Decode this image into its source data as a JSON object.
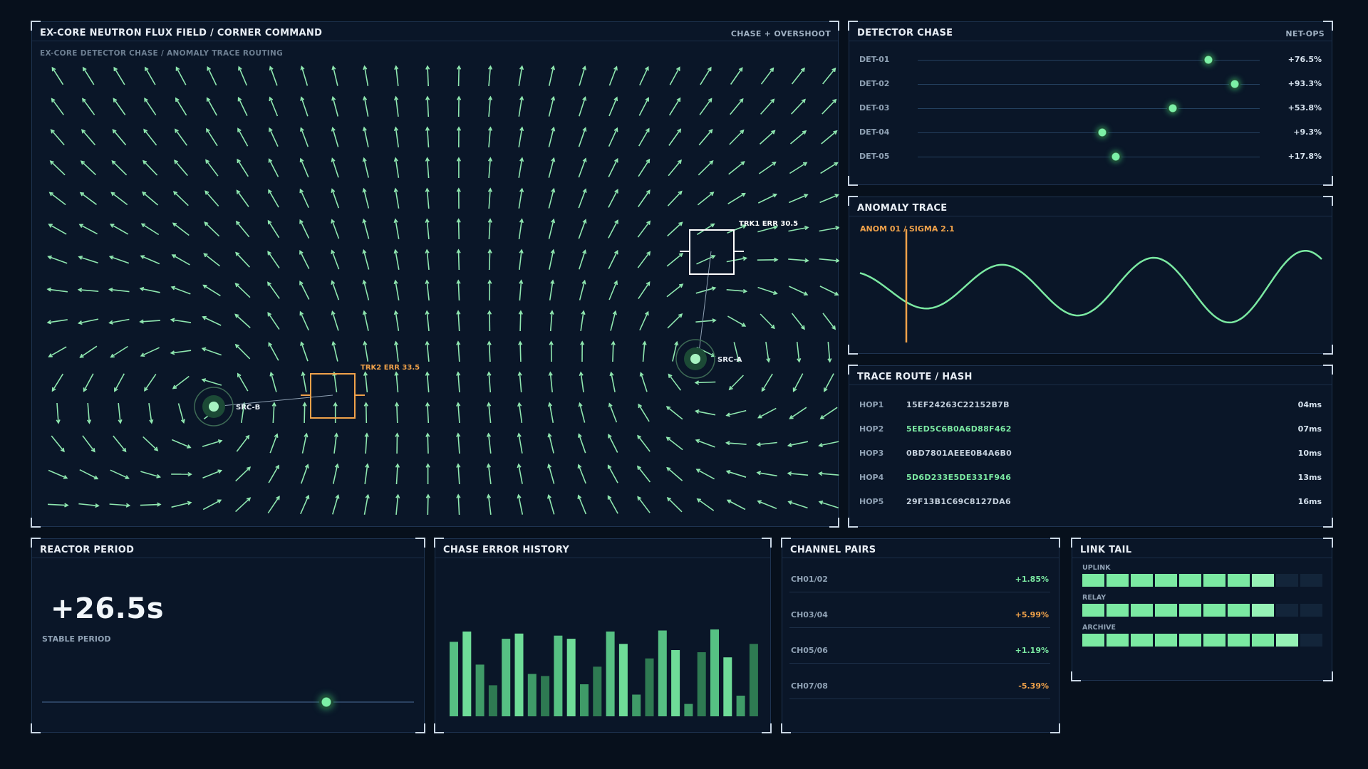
{
  "flux": {
    "title": "EX-CORE NEUTRON FLUX FIELD / CORNER COMMAND",
    "mode": "CHASE + OVERSHOOT",
    "subtitle": "EX-CORE DETECTOR CHASE / ANOMALY TRACE ROUTING",
    "sources": [
      {
        "label": "SRC-A"
      },
      {
        "label": "SRC-B"
      }
    ],
    "trackers": [
      {
        "label": "TRK1 ERR 30.5",
        "color": "#ffffff"
      },
      {
        "label": "TRK2 ERR 33.5",
        "color": "#f0a24a"
      }
    ]
  },
  "detector": {
    "title": "DETECTOR CHASE",
    "tag": "NET-OPS",
    "rows": [
      {
        "label": "DET-01",
        "value": "+76.5%",
        "level": 0.85
      },
      {
        "label": "DET-02",
        "value": "+93.3%",
        "level": 0.927
      },
      {
        "label": "DET-03",
        "value": "+53.8%",
        "level": 0.745
      },
      {
        "label": "DET-04",
        "value": "+9.3%",
        "level": 0.54
      },
      {
        "label": "DET-05",
        "value": "+17.8%",
        "level": 0.58
      }
    ]
  },
  "anomaly": {
    "title": "ANOMALY TRACE",
    "marker_label": "ANOM 01 / SIGMA 2.1",
    "marker_color": "#f0a24a",
    "wave_color": "#7be9a2"
  },
  "trace": {
    "title": "TRACE ROUTE / HASH",
    "hops": [
      {
        "id": "HOP1",
        "hash": "15EF24263C22152B7B",
        "ms": "04ms",
        "green": false
      },
      {
        "id": "HOP2",
        "hash": "5EED5C6B0A6D88F462",
        "ms": "07ms",
        "green": true
      },
      {
        "id": "HOP3",
        "hash": "0BD7801AEEE0B4A6B0",
        "ms": "10ms",
        "green": false
      },
      {
        "id": "HOP4",
        "hash": "5D6D233E5DE331F946",
        "ms": "13ms",
        "green": true
      },
      {
        "id": "HOP5",
        "hash": "29F13B1C69C8127DA6",
        "ms": "16ms",
        "green": false
      }
    ]
  },
  "reactor": {
    "title": "REACTOR PERIOD",
    "value": "+26.5s",
    "caption": "STABLE PERIOD",
    "slider_level": 0.765
  },
  "history": {
    "title": "CHASE ERROR HISTORY",
    "bars": [
      0.72,
      0.82,
      0.5,
      0.3,
      0.75,
      0.8,
      0.41,
      0.39,
      0.78,
      0.75,
      0.31,
      0.48,
      0.82,
      0.7,
      0.21,
      0.56,
      0.83,
      0.64,
      0.12,
      0.62,
      0.84,
      0.57,
      0.2,
      0.7
    ],
    "shades": [
      1,
      0,
      2,
      3,
      1,
      0,
      2,
      3,
      1,
      0,
      2,
      3,
      1,
      0,
      2,
      3,
      1,
      0,
      2,
      3,
      1,
      0,
      2,
      3
    ]
  },
  "channels": {
    "title": "CHANNEL PAIRS",
    "rows": [
      {
        "name": "CH01/02",
        "value": "+1.85%",
        "color": "#7be9a2"
      },
      {
        "name": "CH03/04",
        "value": "+5.99%",
        "color": "#f0a24a"
      },
      {
        "name": "CH05/06",
        "value": "+1.19%",
        "color": "#7be9a2"
      },
      {
        "name": "CH07/08",
        "value": "-5.39%",
        "color": "#f0a24a"
      }
    ]
  },
  "linktail": {
    "title": "LINK TAIL",
    "rows": [
      {
        "label": "UPLINK",
        "filled": 8
      },
      {
        "label": "RELAY",
        "filled": 8
      },
      {
        "label": "ARCHIVE",
        "filled": 9
      }
    ],
    "total": 10
  }
}
